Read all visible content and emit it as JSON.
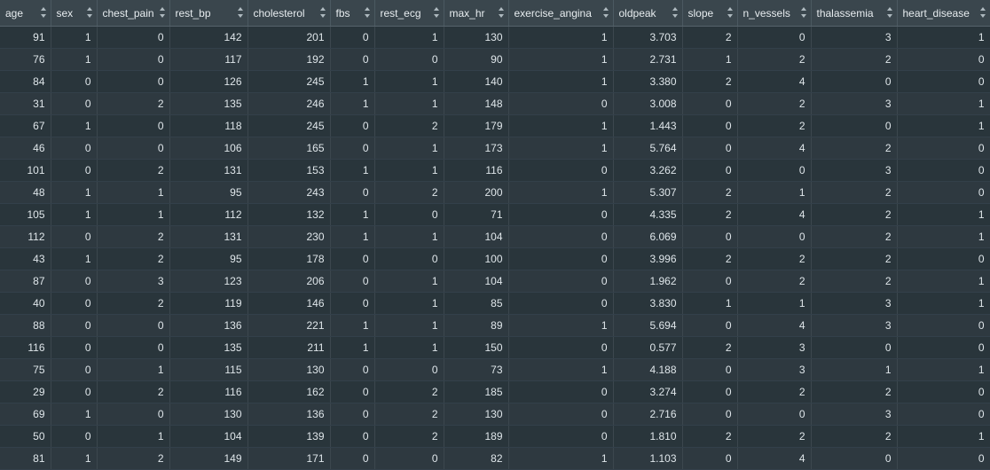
{
  "table": {
    "columns": [
      "age",
      "sex",
      "chest_pain",
      "rest_bp",
      "cholesterol",
      "fbs",
      "rest_ecg",
      "max_hr",
      "exercise_angina",
      "oldpeak",
      "slope",
      "n_vessels",
      "thalassemia",
      "heart_disease"
    ],
    "rows": [
      [
        "91",
        "1",
        "0",
        "142",
        "201",
        "0",
        "1",
        "130",
        "1",
        "3.703",
        "2",
        "0",
        "3",
        "1"
      ],
      [
        "76",
        "1",
        "0",
        "117",
        "192",
        "0",
        "0",
        "90",
        "1",
        "2.731",
        "1",
        "2",
        "2",
        "0"
      ],
      [
        "84",
        "0",
        "0",
        "126",
        "245",
        "1",
        "1",
        "140",
        "1",
        "3.380",
        "2",
        "4",
        "0",
        "0"
      ],
      [
        "31",
        "0",
        "2",
        "135",
        "246",
        "1",
        "1",
        "148",
        "0",
        "3.008",
        "0",
        "2",
        "3",
        "1"
      ],
      [
        "67",
        "1",
        "0",
        "118",
        "245",
        "0",
        "2",
        "179",
        "1",
        "1.443",
        "0",
        "2",
        "0",
        "1"
      ],
      [
        "46",
        "0",
        "0",
        "106",
        "165",
        "0",
        "1",
        "173",
        "1",
        "5.764",
        "0",
        "4",
        "2",
        "0"
      ],
      [
        "101",
        "0",
        "2",
        "131",
        "153",
        "1",
        "1",
        "116",
        "0",
        "3.262",
        "0",
        "0",
        "3",
        "0"
      ],
      [
        "48",
        "1",
        "1",
        "95",
        "243",
        "0",
        "2",
        "200",
        "1",
        "5.307",
        "2",
        "1",
        "2",
        "0"
      ],
      [
        "105",
        "1",
        "1",
        "112",
        "132",
        "1",
        "0",
        "71",
        "0",
        "4.335",
        "2",
        "4",
        "2",
        "1"
      ],
      [
        "112",
        "0",
        "2",
        "131",
        "230",
        "1",
        "1",
        "104",
        "0",
        "6.069",
        "0",
        "0",
        "2",
        "1"
      ],
      [
        "43",
        "1",
        "2",
        "95",
        "178",
        "0",
        "0",
        "100",
        "0",
        "3.996",
        "2",
        "2",
        "2",
        "0"
      ],
      [
        "87",
        "0",
        "3",
        "123",
        "206",
        "0",
        "1",
        "104",
        "0",
        "1.962",
        "0",
        "2",
        "2",
        "1"
      ],
      [
        "40",
        "0",
        "2",
        "119",
        "146",
        "0",
        "1",
        "85",
        "0",
        "3.830",
        "1",
        "1",
        "3",
        "1"
      ],
      [
        "88",
        "0",
        "0",
        "136",
        "221",
        "1",
        "1",
        "89",
        "1",
        "5.694",
        "0",
        "4",
        "3",
        "0"
      ],
      [
        "116",
        "0",
        "0",
        "135",
        "211",
        "1",
        "1",
        "150",
        "0",
        "0.577",
        "2",
        "3",
        "0",
        "0"
      ],
      [
        "75",
        "0",
        "1",
        "115",
        "130",
        "0",
        "0",
        "73",
        "1",
        "4.188",
        "0",
        "3",
        "1",
        "1"
      ],
      [
        "29",
        "0",
        "2",
        "116",
        "162",
        "0",
        "2",
        "185",
        "0",
        "3.274",
        "0",
        "2",
        "2",
        "0"
      ],
      [
        "69",
        "1",
        "0",
        "130",
        "136",
        "0",
        "2",
        "130",
        "0",
        "2.716",
        "0",
        "0",
        "3",
        "0"
      ],
      [
        "50",
        "0",
        "1",
        "104",
        "139",
        "0",
        "2",
        "189",
        "0",
        "1.810",
        "2",
        "2",
        "2",
        "1"
      ],
      [
        "81",
        "1",
        "2",
        "149",
        "171",
        "0",
        "0",
        "82",
        "1",
        "1.103",
        "0",
        "4",
        "0",
        "0"
      ]
    ]
  }
}
